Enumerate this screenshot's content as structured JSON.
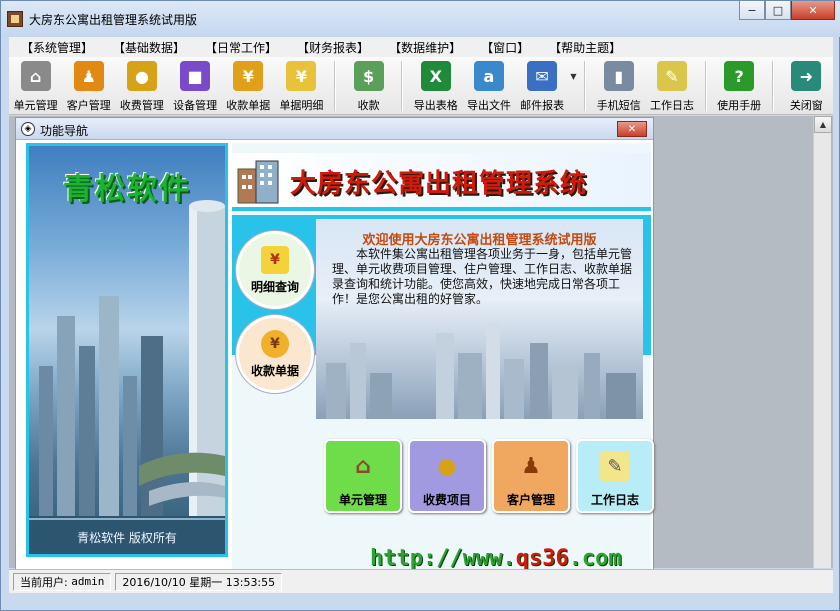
{
  "window": {
    "title": "大房东公寓出租管理系统试用版",
    "minimize": "−",
    "maximize": "□",
    "close": "✕"
  },
  "menu": [
    "【系统管理】",
    "【基础数据】",
    "【日常工作】",
    "【财务报表】",
    "【数据维护】",
    "【窗口】",
    "【帮助主题】"
  ],
  "toolbar": {
    "group1": [
      {
        "label": "单元管理",
        "icon": "house-icon",
        "glyph": "⌂",
        "color": "#8a8a8a"
      },
      {
        "label": "客户管理",
        "icon": "people-icon",
        "glyph": "♟",
        "color": "#e08a14"
      },
      {
        "label": "收费管理",
        "icon": "coins-icon",
        "glyph": "●",
        "color": "#d6a217"
      },
      {
        "label": "设备管理",
        "icon": "cubes-icon",
        "glyph": "■",
        "color": "#7a4bc9"
      },
      {
        "label": "收款单据",
        "icon": "yen-coin-icon",
        "glyph": "¥",
        "color": "#e0a019"
      },
      {
        "label": "单据明细",
        "icon": "receipt-icon",
        "glyph": "¥",
        "color": "#e8c23a"
      }
    ],
    "group2": [
      {
        "label": "收款",
        "icon": "money-icon",
        "glyph": "$",
        "color": "#5aa05a"
      }
    ],
    "group3": [
      {
        "label": "导出表格",
        "icon": "excel-icon",
        "glyph": "X",
        "color": "#1f8a3a"
      },
      {
        "label": "导出文件",
        "icon": "text-file-icon",
        "glyph": "a",
        "color": "#3a8acb"
      },
      {
        "label": "邮件报表",
        "icon": "mail-icon",
        "glyph": "✉",
        "color": "#3b6fc2"
      }
    ],
    "group4": [
      {
        "label": "手机短信",
        "icon": "phone-icon",
        "glyph": "▮",
        "color": "#7a8aa0"
      },
      {
        "label": "工作日志",
        "icon": "notepad-icon",
        "glyph": "✎",
        "color": "#d9c64a"
      }
    ],
    "group5": [
      {
        "label": "使用手册",
        "icon": "help-icon",
        "glyph": "?",
        "color": "#2a9a2a"
      }
    ],
    "group6": [
      {
        "label": "关闭窗",
        "icon": "exit-icon",
        "glyph": "➜",
        "color": "#2a8a7a"
      }
    ]
  },
  "nav": {
    "title": "功能导航",
    "close": "✕",
    "banner_title": "青松软件",
    "banner_footer": "青松软件  版权所有",
    "header_title": "大房东公寓出租管理系统",
    "welcome_title": "欢迎使用大房东公寓出租管理系统试用版",
    "welcome_body": "本软件集公寓出租管理各项业务于一身，包括单元管理、单元收费项目管理、住户管理、工作日志、收款单据录查询和统计功能。使您高效，快速地完成日常各项工作！是您公寓出租的好管家。",
    "circles": [
      {
        "label": "明细查询",
        "icon": "receipt-icon",
        "glyph": "¥",
        "bg": "#e9f7e4"
      },
      {
        "label": "收款单据",
        "icon": "yen-coin-icon",
        "glyph": "¥",
        "bg": "#fbe7cf"
      }
    ],
    "tiles": [
      {
        "label": "单元管理",
        "icon": "house-icon",
        "glyph": "⌂",
        "bg": "#6fdc4a"
      },
      {
        "label": "收费项目",
        "icon": "coins-icon",
        "glyph": "●",
        "bg": "#a29ae0"
      },
      {
        "label": "客户管理",
        "icon": "people-icon",
        "glyph": "♟",
        "bg": "#f0a860"
      },
      {
        "label": "工作日志",
        "icon": "notepad-icon",
        "glyph": "✎",
        "bg": "#b8ecf6"
      }
    ],
    "url_prefix": "http://www.",
    "url_domain": "qs36",
    "url_suffix": ".com"
  },
  "status": {
    "user_label": "当前用户:",
    "user": "admin",
    "datetime": "2016/10/10 星期一 13:53:55"
  }
}
